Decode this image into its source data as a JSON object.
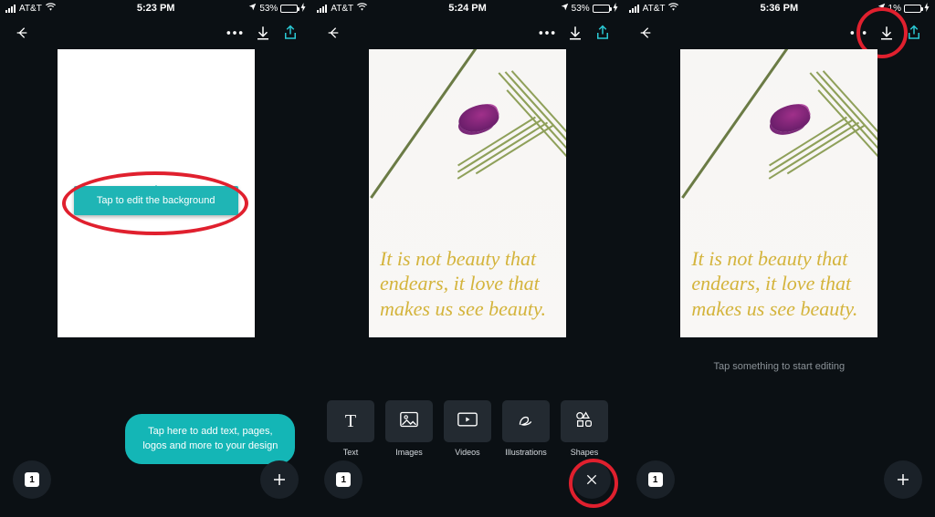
{
  "statusbar": {
    "carrier": "AT&T",
    "location_icon": "◤",
    "bolt": "↯",
    "time1": "5:23 PM",
    "time2": "5:24 PM",
    "time3": "5:36 PM",
    "battery1": "53%",
    "battery2": "53%",
    "battery3": "1%",
    "battery3_display": ""
  },
  "header": {
    "download_icon": "download-icon",
    "share_icon": "share-icon"
  },
  "canvas": {
    "quote": "It is not beauty that endears, it love that makes us see beauty."
  },
  "tips": {
    "background": "Tap to edit the background",
    "add_elements": "Tap here to add text, pages, logos and more to your design"
  },
  "status_text": "Tap something to start editing",
  "toolbar": {
    "items": [
      {
        "label": "Text"
      },
      {
        "label": "Images"
      },
      {
        "label": "Videos"
      },
      {
        "label": "Illustrations"
      },
      {
        "label": "Shapes"
      }
    ]
  },
  "fab": {
    "page_number": "1",
    "plus": "+",
    "close": "×"
  },
  "colors": {
    "accent_teal": "#14b6b6",
    "accent_share": "#2bc9d4",
    "highlight_ring": "#e0202e",
    "quote_gold": "#d4b43c"
  }
}
